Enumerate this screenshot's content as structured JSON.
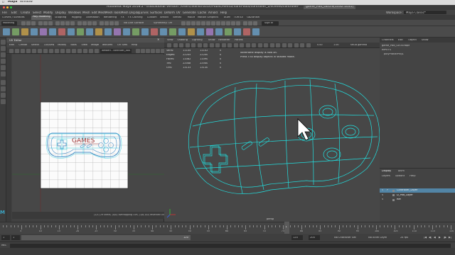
{
  "mac_menu": {
    "app": "Maya",
    "window": "Window"
  },
  "title_bar": {
    "title": "Autodesk Maya 2018.2 - Educational Version: /Users/3dinstructor/Public/Rev42/hand-outs/controller_2/scenes/controller-8.ma*",
    "file_tab": "game_Pad_GEO.e[1032:1031]"
  },
  "menus": [
    "File",
    "Edit",
    "Create",
    "Select",
    "Modify",
    "Display",
    "Windows",
    "Mesh",
    "Edit Mesh",
    "Mesh Tools",
    "Mesh Display",
    "Curves",
    "Surfaces",
    "Deform",
    "UV",
    "Generate",
    "Cache",
    "Arnold",
    "Help"
  ],
  "workspace": {
    "label": "Workspace :",
    "value": "Maya Classic*"
  },
  "shelf_tabs": [
    "Curves / Surfaces",
    "Poly Modeling",
    "Sculpting",
    "Rigging",
    "Animation",
    "Rendering",
    "FX",
    "FX Caching",
    "Custom",
    "Arnold",
    "Bifrost",
    "MASH",
    "Motion Graphics",
    "XGen",
    "TURTLE",
    "GoZBrush"
  ],
  "active_shelf": "Poly Modeling",
  "status_line": {
    "mode": "Modeling",
    "symmetry": "Symmetry: Off",
    "live": "No Live Surface",
    "sign_in": "Sign In"
  },
  "uv_editor": {
    "title": "UV Editor",
    "menus": [
      "Edit",
      "Create",
      "Select",
      "Cut/Sew",
      "Modify",
      "Tools",
      "View",
      "Image",
      "Textures",
      "UV Sets",
      "Help"
    ],
    "texture": "lambert - controller_colo",
    "sketch_text": "GAMES",
    "status": "(1/1) 29 shells, (0/0) overlapping UVs, (1/8,3/0) reversed UVs"
  },
  "viewport": {
    "menus": [
      "View",
      "Shading",
      "Lighting",
      "Show",
      "Renderer",
      "Panels"
    ],
    "gamma": "sRGB gamma",
    "exposure": "0.00",
    "gamma_value": "1.00",
    "hud": [
      {
        "label": "Verts:",
        "a": "11104",
        "b": "11102",
        "c": "0"
      },
      {
        "label": "Edges:",
        "a": "22205",
        "b": "22200",
        "c": "0"
      },
      {
        "label": "Faces:",
        "a": "11082",
        "b": "11090",
        "c": "0"
      },
      {
        "label": "Tris:",
        "a": "22048",
        "b": "22040",
        "c": "0"
      },
      {
        "label": "UVs:",
        "a": "13133",
        "b": "13130",
        "c": "0"
      }
    ],
    "warning_line1": "Wireframe display is now on.",
    "warning_line2": "Press 5 to display objects in shaded mode.",
    "camera": "persp"
  },
  "channel_box": {
    "tabs": [
      "Channels",
      "Edit",
      "Object",
      "Show"
    ],
    "object": "game_Pad_GEOShape",
    "inputs": "INPUTS",
    "input_node": "polyPlanarProj1",
    "menus_top": [
      "Display",
      "Anim"
    ],
    "menus": [
      "Layers",
      "Options",
      "Help"
    ],
    "layers": [
      {
        "v": "V",
        "p": "P",
        "name": "Controller_Layer",
        "selected": true
      },
      {
        "v": "V",
        "p": "",
        "name": "D_Pad_Layer",
        "selected": false
      },
      {
        "v": "V",
        "p": "",
        "name": "Ref",
        "selected": false
      }
    ]
  },
  "timeline": {
    "ticks": [
      "5",
      "10",
      "15",
      "20",
      "25",
      "30",
      "35",
      "40",
      "45",
      "50",
      "55",
      "60",
      "65",
      "70",
      "75",
      "80",
      "85",
      "90",
      "95",
      "100",
      "105",
      "110",
      "115",
      "120"
    ],
    "current_frame": "1",
    "range_start": "1",
    "range_start2": "1",
    "range_end": "120",
    "range_end2": "120",
    "anim_end": "200",
    "character_set": "No Character Set",
    "anim_layer": "No Anim Layer",
    "fps": "24 fps"
  },
  "command_line": {
    "label": "MEL"
  },
  "colors": {
    "wire": "#22e0e0",
    "accent": "#5285a6",
    "uv_grid": "#b0b0b0",
    "sketch_blue": "#4a8fc8",
    "sketch_red": "#a03030"
  }
}
